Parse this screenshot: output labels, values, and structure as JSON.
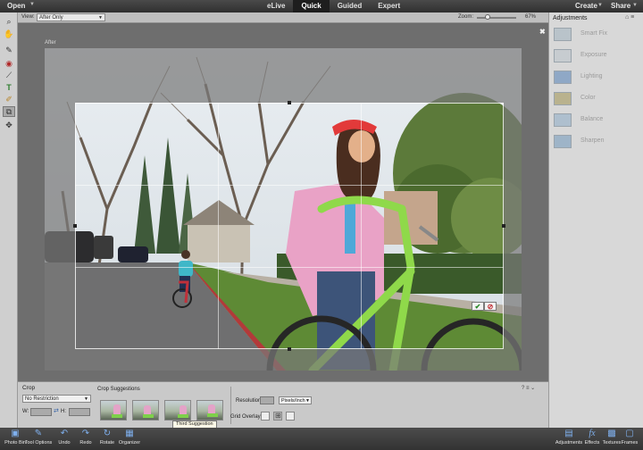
{
  "topbar": {
    "open_label": "Open",
    "modes": [
      {
        "label": "eLive",
        "active": false
      },
      {
        "label": "Quick",
        "active": true
      },
      {
        "label": "Guided",
        "active": false
      },
      {
        "label": "Expert",
        "active": false
      }
    ],
    "create_label": "Create",
    "share_label": "Share"
  },
  "tools": [
    {
      "name": "zoom-tool-icon",
      "glyph": "🔍",
      "selected": false
    },
    {
      "name": "hand-tool-icon",
      "glyph": "✋",
      "selected": false
    },
    {
      "name": "quick-selection-tool-icon",
      "glyph": "✎",
      "selected": false
    },
    {
      "name": "red-eye-tool-icon",
      "glyph": "◉",
      "selected": false
    },
    {
      "name": "whiten-teeth-tool-icon",
      "glyph": "⟋",
      "selected": false
    },
    {
      "name": "type-tool-icon",
      "glyph": "T",
      "selected": false
    },
    {
      "name": "spot-healing-tool-icon",
      "glyph": "✐",
      "selected": false
    },
    {
      "name": "crop-tool-icon",
      "glyph": "⧉",
      "selected": true
    },
    {
      "name": "move-tool-icon",
      "glyph": "✥",
      "selected": false
    }
  ],
  "options": {
    "view_label": "View:",
    "view_value": "After Only",
    "zoom_label": "Zoom:",
    "zoom_value": "67%",
    "zoom_level_fraction": 0.25
  },
  "canvas": {
    "after_label": "After"
  },
  "adjustments": {
    "title": "Adjustments",
    "items": [
      {
        "label": "Smart Fix"
      },
      {
        "label": "Exposure"
      },
      {
        "label": "Lighting"
      },
      {
        "label": "Color"
      },
      {
        "label": "Balance"
      },
      {
        "label": "Sharpen"
      }
    ]
  },
  "crop_panel": {
    "title": "Crop",
    "restriction": "No Restriction",
    "w_label": "W:",
    "h_label": "H:",
    "suggestions_title": "Crop Suggestions",
    "tooltip": "Third Suggestion",
    "resolution_label": "Resolution:",
    "resolution_unit": "Pixels/Inch",
    "grid_overlay_label": "Grid Overlay:"
  },
  "taskbar": {
    "left": [
      {
        "label": "Photo Bin",
        "icon": "photo-bin-icon",
        "glyph": "▣"
      },
      {
        "label": "Tool Options",
        "icon": "tool-options-icon",
        "glyph": "✎"
      },
      {
        "label": "Undo",
        "icon": "undo-icon",
        "glyph": "↶"
      },
      {
        "label": "Redo",
        "icon": "redo-icon",
        "glyph": "↷"
      },
      {
        "label": "Rotate",
        "icon": "rotate-icon",
        "glyph": "↻"
      },
      {
        "label": "Organizer",
        "icon": "organizer-icon",
        "glyph": "▦"
      }
    ],
    "right": [
      {
        "label": "Adjustments",
        "icon": "adjustments-icon",
        "glyph": "▤"
      },
      {
        "label": "Effects",
        "icon": "effects-icon",
        "glyph": "fx"
      },
      {
        "label": "Textures",
        "icon": "textures-icon",
        "glyph": "▩"
      },
      {
        "label": "Frames",
        "icon": "frames-icon",
        "glyph": "▢"
      }
    ]
  },
  "colors": {
    "active_tab_bg": "#1e1e1e",
    "crop_confirm": "#2a8a2a",
    "crop_cancel": "#c0262c",
    "icon_blue": "#7fb0ee"
  }
}
